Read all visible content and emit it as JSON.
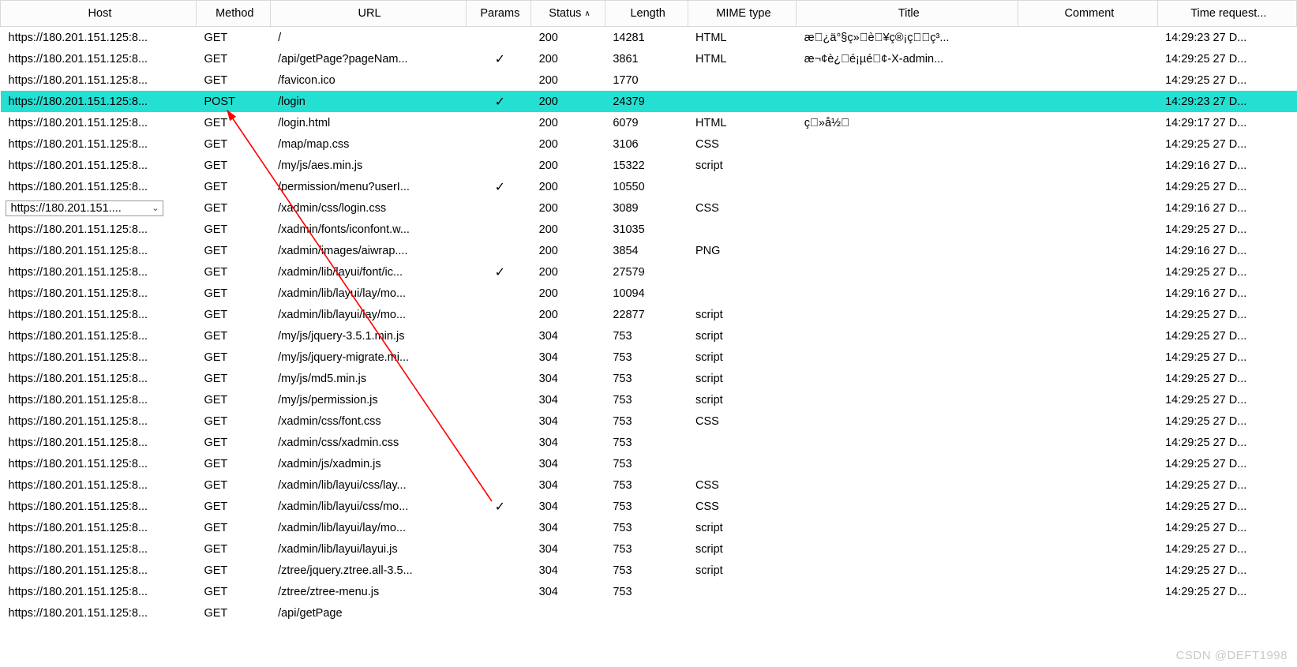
{
  "columns": {
    "host": "Host",
    "method": "Method",
    "url": "URL",
    "params": "Params",
    "status": "Status",
    "length": "Length",
    "mime": "MIME type",
    "title": "Title",
    "comment": "Comment",
    "time": "Time request..."
  },
  "sort_column": "status",
  "dropdown_value": "https://180.201.151....",
  "watermark": "CSDN @DEFT1998",
  "rows": [
    {
      "host": "https://180.201.151.125:8...",
      "method": "GET",
      "url": "/",
      "params": "",
      "status": "200",
      "length": "14281",
      "mime": "HTML",
      "title": "æ\u0000¿ä°§ç»\u0000è\u0000¥ç®¡ç\u0000\u0000ç³...",
      "comment": "",
      "time": "14:29:23 27 D..."
    },
    {
      "host": "https://180.201.151.125:8...",
      "method": "GET",
      "url": "/api/getPage?pageNam...",
      "params": "✓",
      "status": "200",
      "length": "3861",
      "mime": "HTML",
      "title": "æ¬¢è¿\u0000é¡µé\u0000¢-X-admin...",
      "comment": "",
      "time": "14:29:25 27 D..."
    },
    {
      "host": "https://180.201.151.125:8...",
      "method": "GET",
      "url": "/favicon.ico",
      "params": "",
      "status": "200",
      "length": "1770",
      "mime": "",
      "title": "",
      "comment": "",
      "time": "14:29:25 27 D..."
    },
    {
      "host": "https://180.201.151.125:8...",
      "method": "POST",
      "url": "/login",
      "params": "✓",
      "status": "200",
      "length": "24379",
      "mime": "",
      "title": "",
      "comment": "",
      "time": "14:29:23 27 D...",
      "selected": true
    },
    {
      "host": "https://180.201.151.125:8...",
      "method": "GET",
      "url": "/login.html",
      "params": "",
      "status": "200",
      "length": "6079",
      "mime": "HTML",
      "title": "ç\u0000»å½\u0000",
      "comment": "",
      "time": "14:29:17 27 D..."
    },
    {
      "host": "https://180.201.151.125:8...",
      "method": "GET",
      "url": "/map/map.css",
      "params": "",
      "status": "200",
      "length": "3106",
      "mime": "CSS",
      "title": "",
      "comment": "",
      "time": "14:29:25 27 D..."
    },
    {
      "host": "https://180.201.151.125:8...",
      "method": "GET",
      "url": "/my/js/aes.min.js",
      "params": "",
      "status": "200",
      "length": "15322",
      "mime": "script",
      "title": "",
      "comment": "",
      "time": "14:29:16 27 D..."
    },
    {
      "host": "https://180.201.151.125:8...",
      "method": "GET",
      "url": "/permission/menu?userI...",
      "params": "✓",
      "status": "200",
      "length": "10550",
      "mime": "",
      "title": "",
      "comment": "",
      "time": "14:29:25 27 D..."
    },
    {
      "host": "__DROPDOWN__",
      "method": "GET",
      "url": "/xadmin/css/login.css",
      "params": "",
      "status": "200",
      "length": "3089",
      "mime": "CSS",
      "title": "",
      "comment": "",
      "time": "14:29:16 27 D..."
    },
    {
      "host": "https://180.201.151.125:8...",
      "method": "GET",
      "url": "/xadmin/fonts/iconfont.w...",
      "params": "",
      "status": "200",
      "length": "31035",
      "mime": "",
      "title": "",
      "comment": "",
      "time": "14:29:25 27 D..."
    },
    {
      "host": "https://180.201.151.125:8...",
      "method": "GET",
      "url": "/xadmin/images/aiwrap....",
      "params": "",
      "status": "200",
      "length": "3854",
      "mime": "PNG",
      "title": "",
      "comment": "",
      "time": "14:29:16 27 D..."
    },
    {
      "host": "https://180.201.151.125:8...",
      "method": "GET",
      "url": "/xadmin/lib/layui/font/ic...",
      "params": "✓",
      "status": "200",
      "length": "27579",
      "mime": "",
      "title": "",
      "comment": "",
      "time": "14:29:25 27 D..."
    },
    {
      "host": "https://180.201.151.125:8...",
      "method": "GET",
      "url": "/xadmin/lib/layui/lay/mo...",
      "params": "",
      "status": "200",
      "length": "10094",
      "mime": "",
      "title": "",
      "comment": "",
      "time": "14:29:16 27 D..."
    },
    {
      "host": "https://180.201.151.125:8...",
      "method": "GET",
      "url": "/xadmin/lib/layui/lay/mo...",
      "params": "",
      "status": "200",
      "length": "22877",
      "mime": "script",
      "title": "",
      "comment": "",
      "time": "14:29:25 27 D..."
    },
    {
      "host": "https://180.201.151.125:8...",
      "method": "GET",
      "url": "/my/js/jquery-3.5.1.min.js",
      "params": "",
      "status": "304",
      "length": "753",
      "mime": "script",
      "title": "",
      "comment": "",
      "time": "14:29:25 27 D..."
    },
    {
      "host": "https://180.201.151.125:8...",
      "method": "GET",
      "url": "/my/js/jquery-migrate.mi...",
      "params": "",
      "status": "304",
      "length": "753",
      "mime": "script",
      "title": "",
      "comment": "",
      "time": "14:29:25 27 D..."
    },
    {
      "host": "https://180.201.151.125:8...",
      "method": "GET",
      "url": "/my/js/md5.min.js",
      "params": "",
      "status": "304",
      "length": "753",
      "mime": "script",
      "title": "",
      "comment": "",
      "time": "14:29:25 27 D..."
    },
    {
      "host": "https://180.201.151.125:8...",
      "method": "GET",
      "url": "/my/js/permission.js",
      "params": "",
      "status": "304",
      "length": "753",
      "mime": "script",
      "title": "",
      "comment": "",
      "time": "14:29:25 27 D..."
    },
    {
      "host": "https://180.201.151.125:8...",
      "method": "GET",
      "url": "/xadmin/css/font.css",
      "params": "",
      "status": "304",
      "length": "753",
      "mime": "CSS",
      "title": "",
      "comment": "",
      "time": "14:29:25 27 D..."
    },
    {
      "host": "https://180.201.151.125:8...",
      "method": "GET",
      "url": "/xadmin/css/xadmin.css",
      "params": "",
      "status": "304",
      "length": "753",
      "mime": "",
      "title": "",
      "comment": "",
      "time": "14:29:25 27 D..."
    },
    {
      "host": "https://180.201.151.125:8...",
      "method": "GET",
      "url": "/xadmin/js/xadmin.js",
      "params": "",
      "status": "304",
      "length": "753",
      "mime": "",
      "title": "",
      "comment": "",
      "time": "14:29:25 27 D..."
    },
    {
      "host": "https://180.201.151.125:8...",
      "method": "GET",
      "url": "/xadmin/lib/layui/css/lay...",
      "params": "",
      "status": "304",
      "length": "753",
      "mime": "CSS",
      "title": "",
      "comment": "",
      "time": "14:29:25 27 D..."
    },
    {
      "host": "https://180.201.151.125:8...",
      "method": "GET",
      "url": "/xadmin/lib/layui/css/mo...",
      "params": "✓",
      "status": "304",
      "length": "753",
      "mime": "CSS",
      "title": "",
      "comment": "",
      "time": "14:29:25 27 D..."
    },
    {
      "host": "https://180.201.151.125:8...",
      "method": "GET",
      "url": "/xadmin/lib/layui/lay/mo...",
      "params": "",
      "status": "304",
      "length": "753",
      "mime": "script",
      "title": "",
      "comment": "",
      "time": "14:29:25 27 D..."
    },
    {
      "host": "https://180.201.151.125:8...",
      "method": "GET",
      "url": "/xadmin/lib/layui/layui.js",
      "params": "",
      "status": "304",
      "length": "753",
      "mime": "script",
      "title": "",
      "comment": "",
      "time": "14:29:25 27 D..."
    },
    {
      "host": "https://180.201.151.125:8...",
      "method": "GET",
      "url": "/ztree/jquery.ztree.all-3.5...",
      "params": "",
      "status": "304",
      "length": "753",
      "mime": "script",
      "title": "",
      "comment": "",
      "time": "14:29:25 27 D..."
    },
    {
      "host": "https://180.201.151.125:8...",
      "method": "GET",
      "url": "/ztree/ztree-menu.js",
      "params": "",
      "status": "304",
      "length": "753",
      "mime": "",
      "title": "",
      "comment": "",
      "time": "14:29:25 27 D..."
    },
    {
      "host": "https://180.201.151.125:8...",
      "method": "GET",
      "url": "/api/getPage",
      "params": "",
      "status": "",
      "length": "",
      "mime": "",
      "title": "",
      "comment": "",
      "time": ""
    }
  ]
}
